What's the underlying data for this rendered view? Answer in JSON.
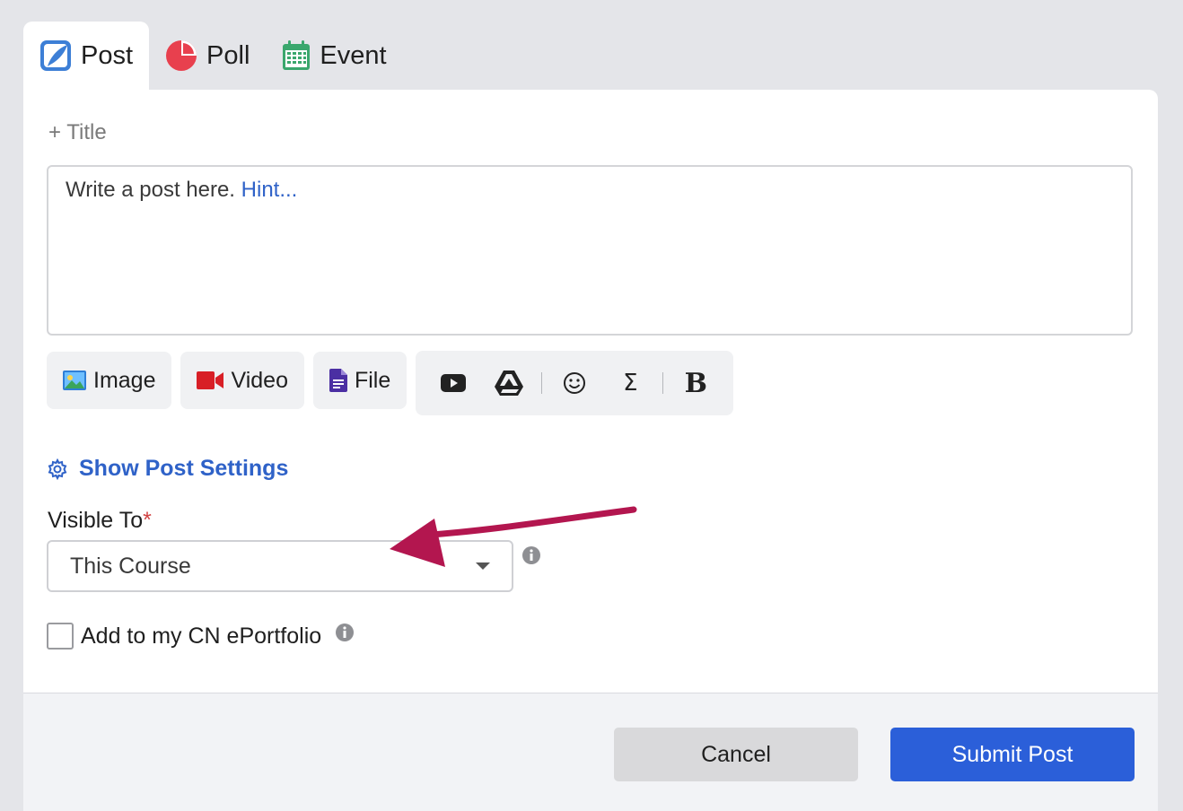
{
  "tabs": [
    {
      "label": "Post",
      "icon": "quill-post-icon",
      "active": true
    },
    {
      "label": "Poll",
      "icon": "pie-poll-icon",
      "active": false
    },
    {
      "label": "Event",
      "icon": "calendar-event-icon",
      "active": false
    }
  ],
  "composer": {
    "add_title": "+ Title",
    "placeholder": "Write a post here.",
    "hint": "Hint..."
  },
  "toolbar": {
    "image_label": "Image",
    "video_label": "Video",
    "file_label": "File",
    "tools": [
      "youtube-icon",
      "google-drive-icon",
      "emoji-icon",
      "sigma-icon",
      "bold-icon"
    ],
    "sigma_glyph": "Σ",
    "bold_glyph": "B"
  },
  "settings": {
    "show_settings_label": "Show Post Settings",
    "visible_to_label": "Visible To",
    "required_mark": "*",
    "visible_to_value": "This Course",
    "portfolio_label": "Add to my CN ePortfolio"
  },
  "footer": {
    "cancel_label": "Cancel",
    "submit_label": "Submit Post"
  },
  "colors": {
    "accent": "#2b5fd9",
    "link": "#2f62c8",
    "annotation_arrow": "#b3164f",
    "required": "#d14343"
  }
}
